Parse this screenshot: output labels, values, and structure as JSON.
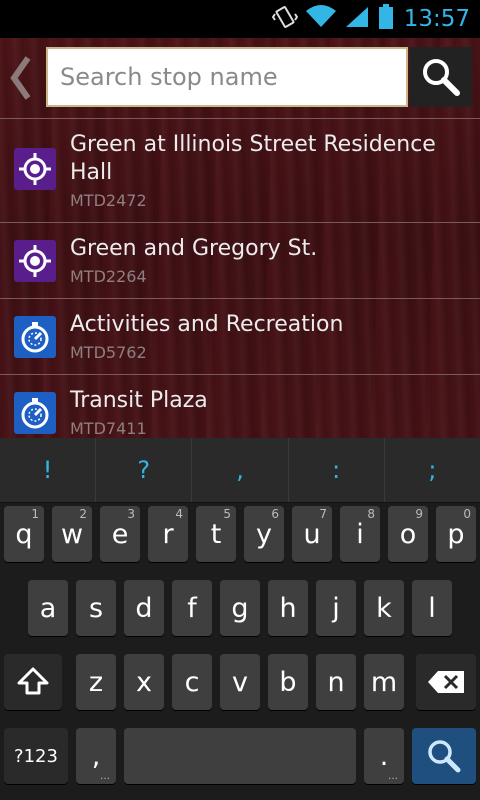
{
  "status_bar": {
    "time": "13:57",
    "icons": [
      "vibrate-icon",
      "wifi-icon",
      "signal-icon",
      "battery-icon"
    ]
  },
  "search": {
    "placeholder": "Search stop name",
    "back_icon": "chevron-left-icon",
    "search_icon": "magnifier-icon"
  },
  "stops": [
    {
      "name": "Green at Illinois Street Residence Hall",
      "code": "MTD2472",
      "icon": "target-icon",
      "color": "#5a1e8c"
    },
    {
      "name": "Green and Gregory St.",
      "code": "MTD2264",
      "icon": "target-icon",
      "color": "#5a1e8c"
    },
    {
      "name": "Activities and Recreation",
      "code": "MTD5762",
      "icon": "stopwatch-icon",
      "color": "#1e5fc4"
    },
    {
      "name": "Transit Plaza",
      "code": "MTD7411",
      "icon": "stopwatch-icon",
      "color": "#1e5fc4"
    }
  ],
  "keyboard": {
    "suggestions": [
      "!",
      "?",
      ",",
      ":",
      ";"
    ],
    "row1": [
      {
        "k": "q",
        "h": "1"
      },
      {
        "k": "w",
        "h": "2"
      },
      {
        "k": "e",
        "h": "3"
      },
      {
        "k": "r",
        "h": "4"
      },
      {
        "k": "t",
        "h": "5"
      },
      {
        "k": "y",
        "h": "6"
      },
      {
        "k": "u",
        "h": "7"
      },
      {
        "k": "i",
        "h": "8"
      },
      {
        "k": "o",
        "h": "9"
      },
      {
        "k": "p",
        "h": "0"
      }
    ],
    "row2": [
      "a",
      "s",
      "d",
      "f",
      "g",
      "h",
      "j",
      "k",
      "l"
    ],
    "row3": [
      "z",
      "x",
      "c",
      "v",
      "b",
      "n",
      "m"
    ],
    "symbols_label": "?123",
    "comma_label": ",",
    "period_label": ".",
    "accent_color": "#33b5e5"
  }
}
